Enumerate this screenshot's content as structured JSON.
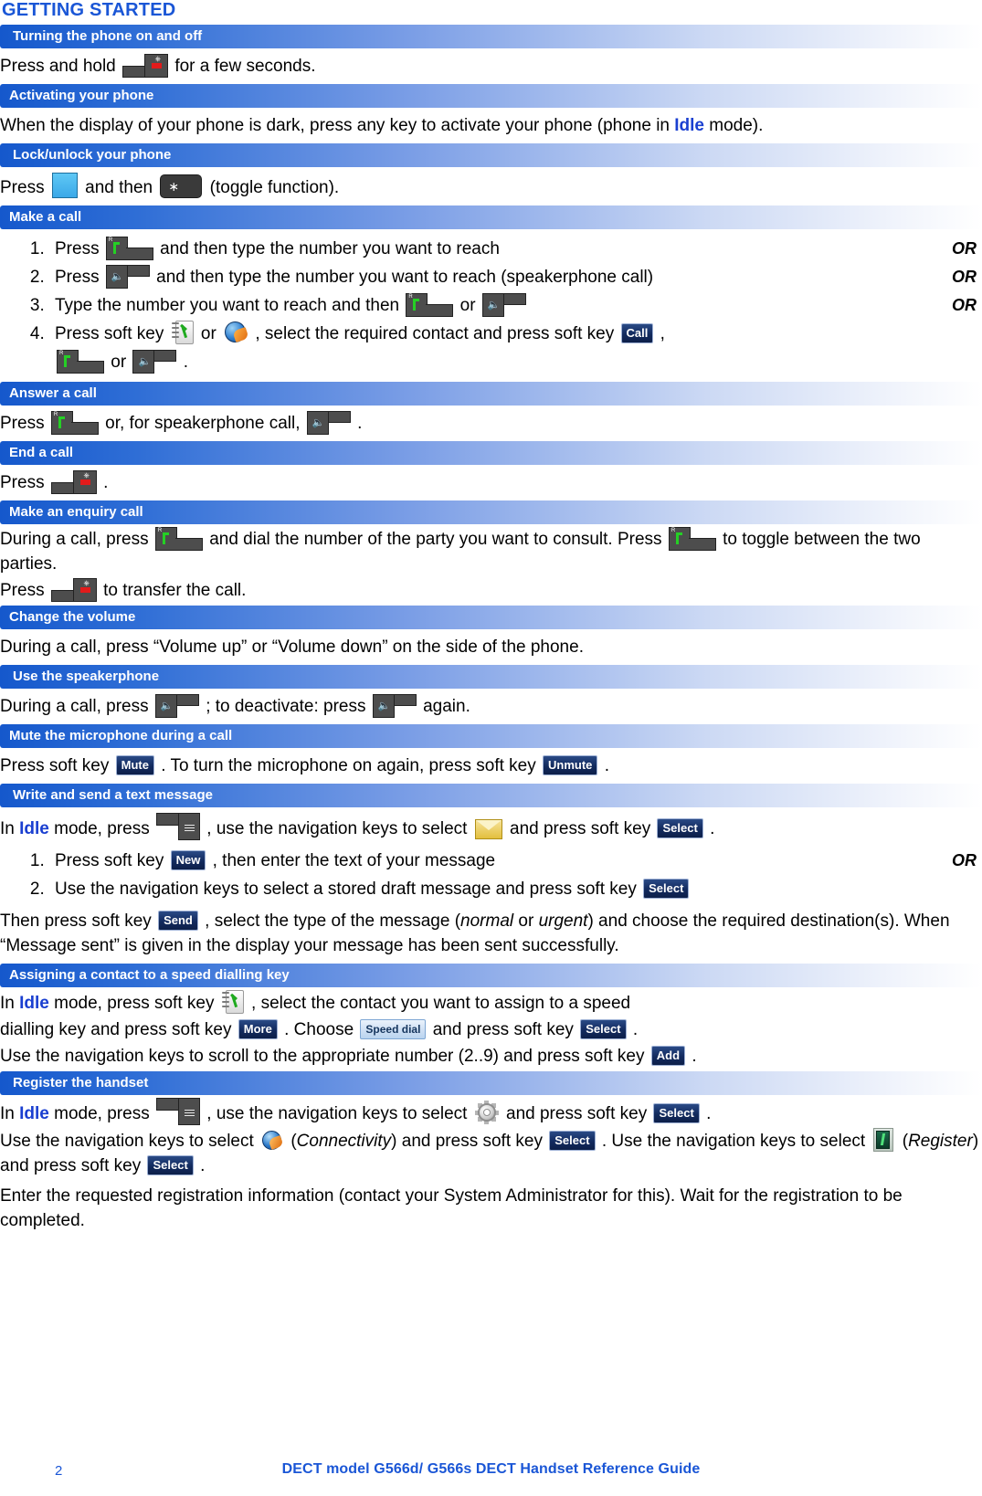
{
  "document": {
    "heading": "GETTING STARTED",
    "footer": {
      "page_number": "2",
      "title": "DECT model G566d/ G566s DECT Handset Reference Guide"
    }
  },
  "icons": {
    "call_key": "off-hook-call-key-icon",
    "end_key": "on-hook-end-call-key-icon",
    "speaker_key": "speakerphone-key-icon",
    "menu_key": "menu-key-icon",
    "blue_key": "blue-function-key-icon",
    "star_key": "star-key-icon",
    "contacts": "contacts-phonebook-icon",
    "globe": "globe-network-icon",
    "envelope": "envelope-message-icon",
    "gear": "settings-gear-icon",
    "connectivity": "connectivity-globe-icon",
    "register": "register-antenna-icon"
  },
  "softkeys": {
    "call": "Call",
    "mute": "Mute",
    "unmute": "Unmute",
    "select": "Select",
    "new": "New",
    "send": "Send",
    "more": "More",
    "add": "Add",
    "speed_dial": "Speed dial"
  },
  "sections": {
    "turning_on_off": {
      "title": "Turning the phone on and off",
      "text_before": "Press and hold",
      "text_after": "for a few seconds."
    },
    "activating": {
      "title": "Activating your phone",
      "text_a": "When the display of your phone is dark, press any key to activate your phone (phone in",
      "idle": "Idle",
      "text_b": "mode)."
    },
    "lock_unlock": {
      "title": "Lock/unlock your phone",
      "text_a": "Press",
      "text_b": "and then",
      "text_c": "(toggle function)."
    },
    "make_call": {
      "title": "Make a call",
      "or": "OR",
      "step1_a": "Press",
      "step1_b": "and then type the number you want to reach",
      "step2_a": "Press",
      "step2_b": "and then type the number you want to reach (speakerphone call)",
      "step3_a": "Type the number you want to reach and then",
      "step3_or": "or",
      "step4_a": "Press soft key",
      "step4_or": "or",
      "step4_b": ", select the required contact and press soft key",
      "step4_c": ",",
      "step4_or2": "or",
      "step4_d": "."
    },
    "answer_call": {
      "title": "Answer a call",
      "text_a": "Press",
      "text_b": "or, for speakerphone call,",
      "text_c": "."
    },
    "end_call": {
      "title": "End a call",
      "text_a": "Press",
      "text_b": "."
    },
    "enquiry_call": {
      "title": "Make an enquiry call",
      "text_a": "During a call, press",
      "text_b": "and dial the number of the party you want to consult. Press",
      "text_c": "to toggle between the two parties.",
      "text_d": "Press",
      "text_e": "to transfer the call."
    },
    "change_volume": {
      "title": "Change the volume",
      "text": "During a call, press “Volume up” or “Volume down” on the side of the phone."
    },
    "use_speakerphone": {
      "title": "Use the speakerphone",
      "text_a": "During a call, press",
      "text_b": "; to deactivate: press",
      "text_c": "again."
    },
    "mute_microphone": {
      "title": "Mute the microphone during a call",
      "text_a": "Press soft key",
      "text_b": ". To turn the microphone on again, press soft key",
      "text_c": "."
    },
    "write_text_message": {
      "title": "Write and send a text message",
      "or": "OR",
      "intro_a": "In",
      "idle": "Idle",
      "intro_b": "mode, press",
      "intro_c": ", use the navigation keys to select",
      "intro_d": "and press soft key",
      "intro_e": ".",
      "step1_a": "Press soft key",
      "step1_b": ", then enter the text of your message",
      "step2_a": "Use the navigation keys to select a stored draft message and press soft key",
      "outro_a": "Then press soft key",
      "outro_b": ", select the type of the message (",
      "normal": "normal",
      "outro_or": "or",
      "urgent": "urgent",
      "outro_c": ") and choose the required destination(s). When “Message sent” is given in the display your message has been sent successfully."
    },
    "speed_dialling": {
      "title": "Assigning a contact to a speed dialling key",
      "line1_a": "In",
      "idle": "Idle",
      "line1_b": "mode, press soft key",
      "line1_c": ", select the contact you want to assign to a speed",
      "line2_a": "dialling key and press soft key",
      "line2_b": ". Choose",
      "line2_c": "and press soft key",
      "line2_d": ".",
      "line3_a": "Use the navigation keys to scroll to the appropriate number (2..9) and press soft key",
      "line3_b": "."
    },
    "register_handset": {
      "title": "Register the handset",
      "line1_a": "In",
      "idle": "Idle",
      "line1_b": "mode, press",
      "line1_c": ", use the navigation keys to select",
      "line1_d": "and press soft key",
      "line1_e": ".",
      "line2_a": "Use the navigation keys to select",
      "connectivity": "Connectivity",
      "line2_b": "(",
      "line2_c": ") and press soft key",
      "line2_d": ". Use the",
      "line3_a": "navigation keys to select",
      "register": "Register",
      "line3_b": "(",
      "line3_c": ") and press soft key",
      "line3_d": ".",
      "line4": "Enter the requested registration information (contact your System Administrator for this). Wait for the registration to be completed."
    }
  }
}
